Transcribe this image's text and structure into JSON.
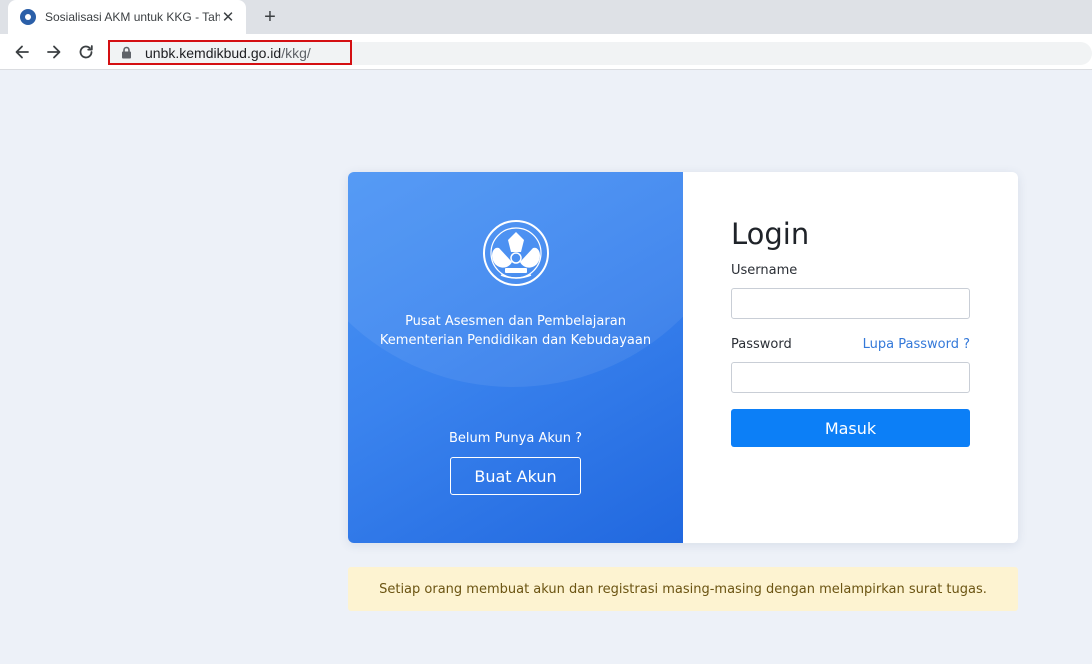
{
  "browser": {
    "tab_title": "Sosialisasi AKM untuk KKG - Tahun",
    "tab_close": "✕",
    "new_tab": "+",
    "url_host": "unbk.kemdikbud.go.id",
    "url_path": "/kkg/"
  },
  "left_panel": {
    "org_line1": "Pusat Asesmen dan Pembelajaran",
    "org_line2": "Kementerian Pendidikan dan Kebudayaan",
    "no_account_text": "Belum Punya Akun ?",
    "create_account_button": "Buat Akun",
    "logo_icon": "tut-wuri-handayani-logo-icon"
  },
  "login": {
    "title": "Login",
    "username_label": "Username",
    "username_value": "",
    "password_label": "Password",
    "password_value": "",
    "forgot_password_link": "Lupa Password ?",
    "submit_button": "Masuk"
  },
  "notice": {
    "text": "Setiap orang membuat akun dan registrasi masing-masing dengan melampirkan surat tugas."
  },
  "colors": {
    "panel_blue": "#3a83ee",
    "primary_button": "#0c7ff7",
    "link": "#3479d9",
    "notice_bg": "#fdf3d1",
    "url_highlight_border": "#d40f12"
  }
}
